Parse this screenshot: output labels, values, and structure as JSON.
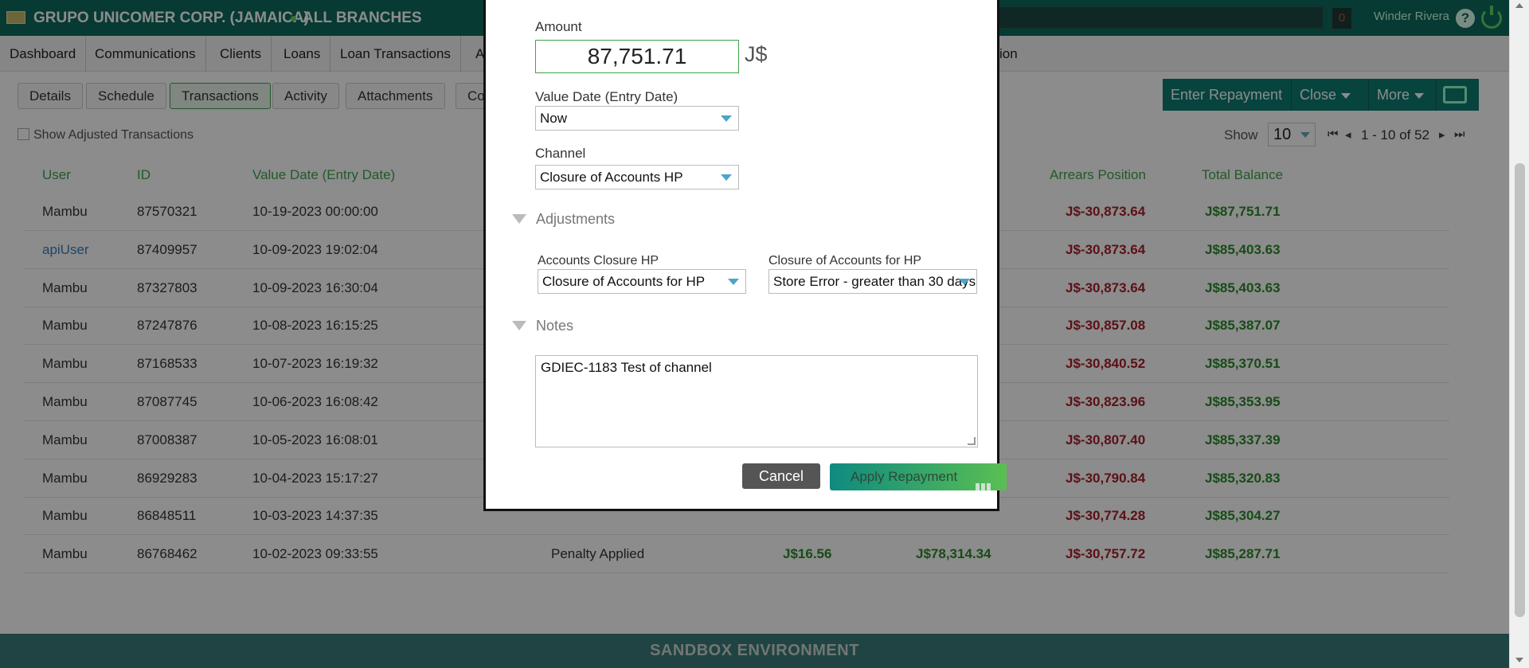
{
  "topbar": {
    "company": "GRUPO UNICOMER CORP. (JAMAICA)",
    "branch": "ALL BRANCHES",
    "notifications": "0",
    "user": "Winder Rivera",
    "help": "?"
  },
  "nav": [
    {
      "label": "Dashboard"
    },
    {
      "label": "Communications"
    },
    {
      "label": "Clients"
    },
    {
      "label": "Loans"
    },
    {
      "label": "Loan Transactions"
    },
    {
      "label": "A"
    },
    {
      "label": "ion"
    }
  ],
  "subtabs": [
    {
      "label": "Details"
    },
    {
      "label": "Schedule"
    },
    {
      "label": "Transactions"
    },
    {
      "label": "Activity"
    },
    {
      "label": "Attachments"
    },
    {
      "label": "Co"
    }
  ],
  "actions": {
    "enter_repayment": "Enter  Repayment",
    "close": "Close",
    "more": "More"
  },
  "show_adjusted": "Show Adjusted Transactions",
  "pager": {
    "show_label": "Show",
    "page_size": "10",
    "range": "1 - 10 of 52"
  },
  "table": {
    "headers": {
      "user": "User",
      "id": "ID",
      "value_date": "Value Date (Entry Date)",
      "arrears": "Arrears Position",
      "total_balance": "Total Balance"
    },
    "rows": [
      {
        "user": "Mambu",
        "id": "87570321",
        "date": "10-19-2023 00:00:00",
        "type": "",
        "amount": "",
        "principal": "",
        "arrears": "J$-30,873.64",
        "balance": "J$87,751.71"
      },
      {
        "user": "apiUser",
        "id": "87409957",
        "date": "10-09-2023 19:02:04",
        "type": "",
        "amount": "",
        "principal": "",
        "arrears": "J$-30,873.64",
        "balance": "J$85,403.63"
      },
      {
        "user": "Mambu",
        "id": "87327803",
        "date": "10-09-2023 16:30:04",
        "type": "",
        "amount": "",
        "principal": "",
        "arrears": "J$-30,873.64",
        "balance": "J$85,403.63"
      },
      {
        "user": "Mambu",
        "id": "87247876",
        "date": "10-08-2023 16:15:25",
        "type": "",
        "amount": "",
        "principal": "",
        "arrears": "J$-30,857.08",
        "balance": "J$85,387.07"
      },
      {
        "user": "Mambu",
        "id": "87168533",
        "date": "10-07-2023 16:19:32",
        "type": "",
        "amount": "",
        "principal": "",
        "arrears": "J$-30,840.52",
        "balance": "J$85,370.51"
      },
      {
        "user": "Mambu",
        "id": "87087745",
        "date": "10-06-2023 16:08:42",
        "type": "",
        "amount": "",
        "principal": "",
        "arrears": "J$-30,823.96",
        "balance": "J$85,353.95"
      },
      {
        "user": "Mambu",
        "id": "87008387",
        "date": "10-05-2023 16:08:01",
        "type": "",
        "amount": "",
        "principal": "",
        "arrears": "J$-30,807.40",
        "balance": "J$85,337.39"
      },
      {
        "user": "Mambu",
        "id": "86929283",
        "date": "10-04-2023 15:17:27",
        "type": "",
        "amount": "",
        "principal": "",
        "arrears": "J$-30,790.84",
        "balance": "J$85,320.83"
      },
      {
        "user": "Mambu",
        "id": "86848511",
        "date": "10-03-2023 14:37:35",
        "type": "",
        "amount": "",
        "principal": "",
        "arrears": "J$-30,774.28",
        "balance": "J$85,304.27"
      },
      {
        "user": "Mambu",
        "id": "86768462",
        "date": "10-02-2023 09:33:55",
        "type": "Penalty Applied",
        "amount": "J$16.56",
        "principal": "J$78,314.34",
        "arrears": "J$-30,757.72",
        "balance": "J$85,287.71"
      }
    ]
  },
  "sandbox": "SANDBOX ENVIRONMENT",
  "modal": {
    "amount_label": "Amount",
    "amount_value": "87,751.71",
    "currency": "J$",
    "value_date_label": "Value Date (Entry Date)",
    "value_date_value": "Now",
    "channel_label": "Channel",
    "channel_value": "Closure of Accounts HP",
    "adjustments_label": "Adjustments",
    "accounts_closure_label": "Accounts Closure HP",
    "accounts_closure_value": "Closure of Accounts for HP",
    "closure_for_label": "Closure of Accounts for HP",
    "closure_for_value": "Store Error - greater than 30 days",
    "notes_label": "Notes",
    "notes_value": "GDIEC-1183 Test of channel",
    "cancel": "Cancel",
    "apply": "Apply Repayment"
  },
  "colors": {
    "brand": "#0c6b5e",
    "accent_green": "#3fa34d",
    "negative": "#a8202a",
    "positive": "#2a8a2a"
  }
}
